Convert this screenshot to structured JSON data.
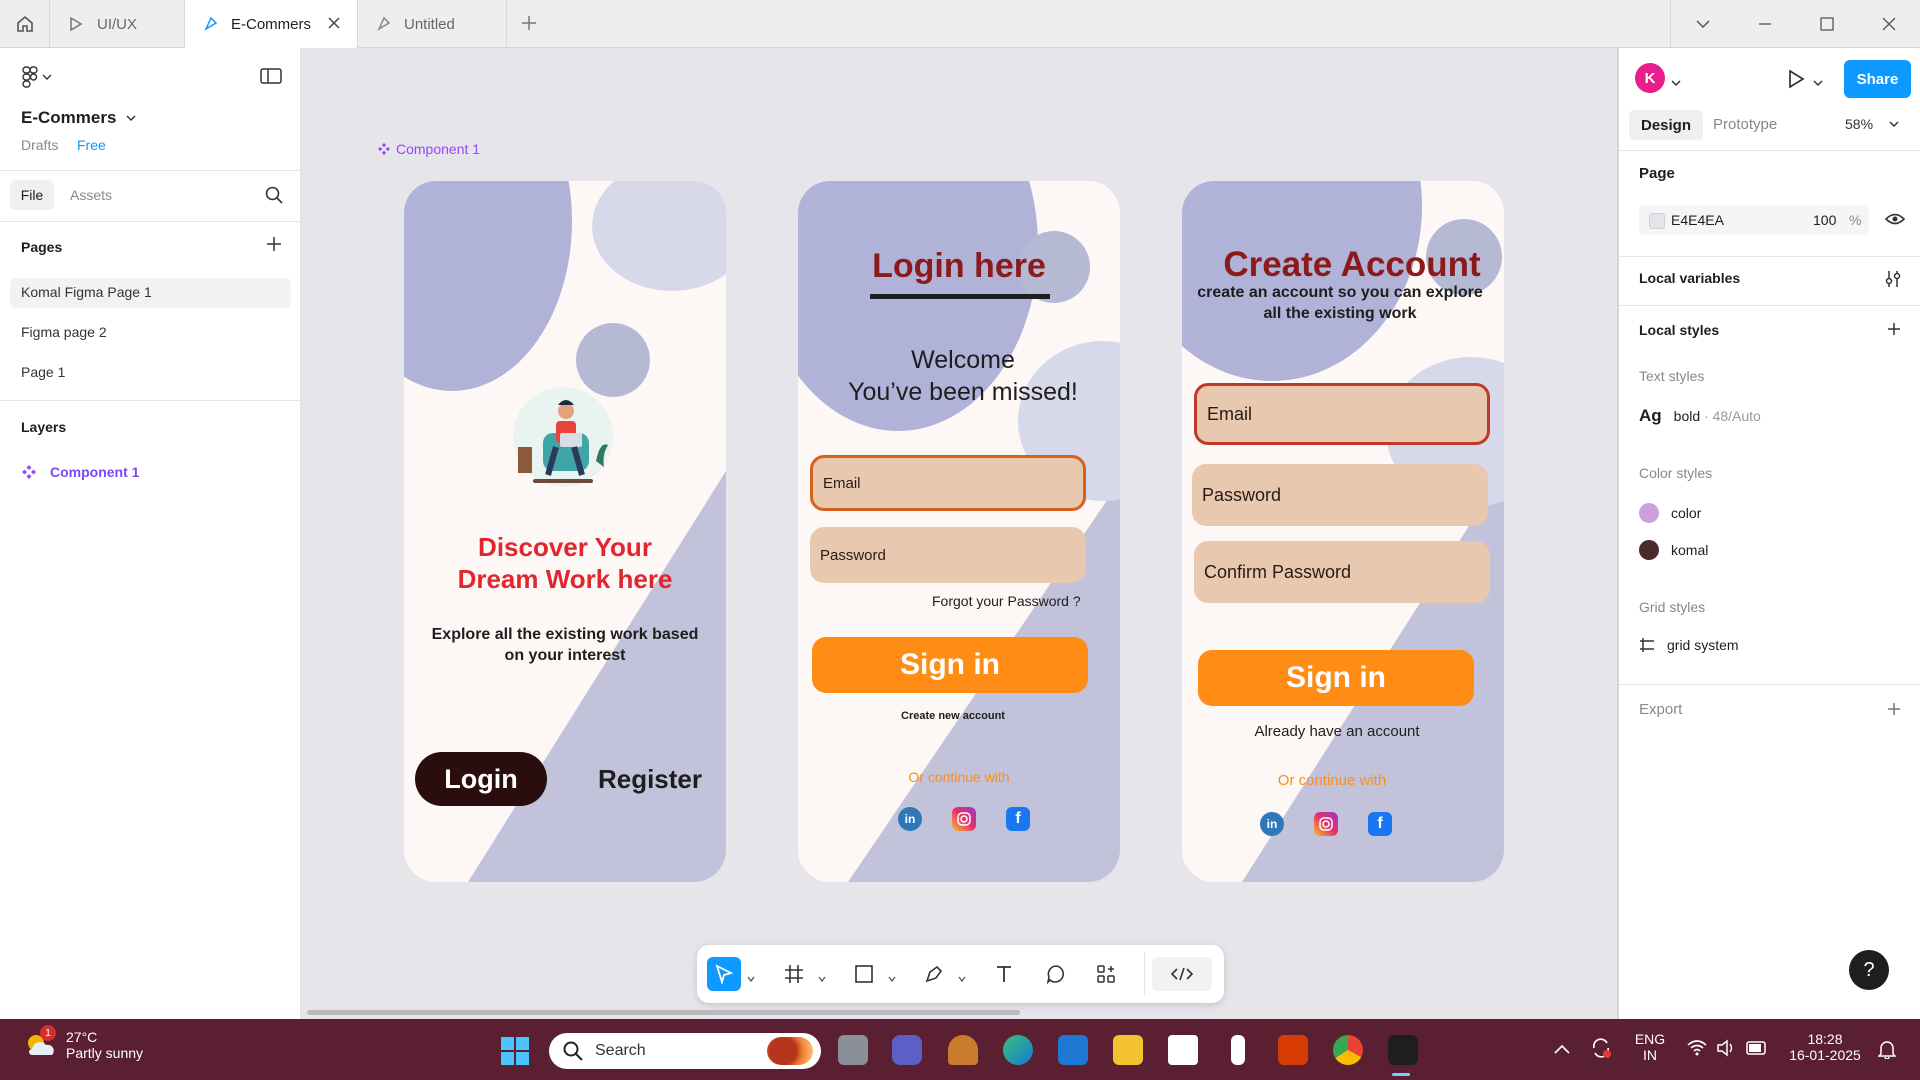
{
  "tabs": {
    "items": [
      {
        "label": "UI/UX"
      },
      {
        "label": "E-Commers"
      },
      {
        "label": "Untitled"
      }
    ]
  },
  "left": {
    "file_name": "E-Commers",
    "drafts": "Drafts",
    "plan": "Free",
    "file_tab": "File",
    "assets_tab": "Assets",
    "pages_heading": "Pages",
    "pages": [
      "Komal Figma Page 1",
      "Figma page 2",
      "Page 1"
    ],
    "layers_heading": "Layers",
    "layer": "Component 1"
  },
  "canvas": {
    "component_label": "Component 1",
    "frame1": {
      "headline_l1": "Discover  Your",
      "headline_l2": "Dream  Work  here",
      "sub": "Explore all the existing work based on your interest",
      "login": "Login",
      "register": "Register"
    },
    "frame2": {
      "title": "Login here",
      "welcome_l1": "Welcome",
      "welcome_l2": "You’ve been missed!",
      "email": "Email",
      "password": "Password",
      "forgot": "Forgot your Password ?",
      "signin": "Sign in",
      "create": "Create new account",
      "continue": "Or continue with"
    },
    "frame3": {
      "title": "Create Account",
      "sub": "create an account so you can explore all the existing work",
      "email": "Email",
      "password": "Password",
      "confirm": "Confirm Password",
      "signin": "Sign in",
      "already": "Already have an account",
      "continue": "Or continue with"
    },
    "social": {
      "linkedin": "in",
      "facebook": "f"
    }
  },
  "right": {
    "avatar": "K",
    "share": "Share",
    "design_tab": "Design",
    "prototype_tab": "Prototype",
    "zoom": "58%",
    "page_heading": "Page",
    "page_color": "E4E4EA",
    "page_opacity": "100",
    "pct": "%",
    "local_variables": "Local variables",
    "local_styles": "Local styles",
    "text_styles": "Text styles",
    "text_style": {
      "glyph": "Ag",
      "name": "bold",
      "meta": " · 48/Auto"
    },
    "color_styles": "Color styles",
    "colors": [
      {
        "name": "color",
        "hex": "#c9a0dc"
      },
      {
        "name": "komal",
        "hex": "#4a2a2a"
      }
    ],
    "grid_styles": "Grid styles",
    "grid": "grid system",
    "export": "Export",
    "help": "?"
  },
  "taskbar": {
    "weather_badge": "1",
    "temp": "27°C",
    "condition": "Partly sunny",
    "search": "Search",
    "lang1": "ENG",
    "lang2": "IN",
    "time": "18:28",
    "date": "16-01-2025"
  },
  "colors": {
    "accent": "#0d99ff",
    "component": "#9747ff",
    "orange": "#ff8c14",
    "maroon": "#8b1a1a",
    "field": "#e8c9b0",
    "taskbar": "#5a2032"
  }
}
